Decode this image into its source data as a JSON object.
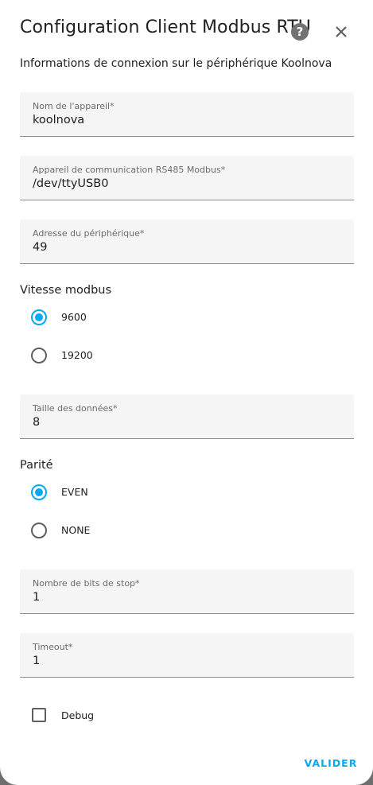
{
  "dialog": {
    "title": "Configuration Client Modbus RTU",
    "subtitle": "Informations de connexion sur le périphérique Koolnova",
    "help_icon": "?",
    "close_icon": "close-icon"
  },
  "fields": {
    "device_name": {
      "label": "Nom de l'appareil*",
      "value": "koolnova"
    },
    "com_device": {
      "label": "Appareil de communication RS485 Modbus*",
      "value": "/dev/ttyUSB0"
    },
    "address": {
      "label": "Adresse du périphérique*",
      "value": "49"
    },
    "data_size": {
      "label": "Taille des données*",
      "value": "8"
    },
    "stop_bits": {
      "label": "Nombre de bits de stop*",
      "value": "1"
    },
    "timeout": {
      "label": "Timeout*",
      "value": "1"
    }
  },
  "speed": {
    "label": "Vitesse modbus",
    "options": [
      "9600",
      "19200"
    ],
    "selected": "9600"
  },
  "parity": {
    "label": "Parité",
    "options": [
      "EVEN",
      "NONE"
    ],
    "selected": "EVEN"
  },
  "debug": {
    "label": "Debug",
    "checked": false
  },
  "actions": {
    "submit_label": "VALIDER"
  },
  "colors": {
    "accent": "#03a9f4",
    "field_bg": "#f5f5f5",
    "text": "#212121"
  }
}
